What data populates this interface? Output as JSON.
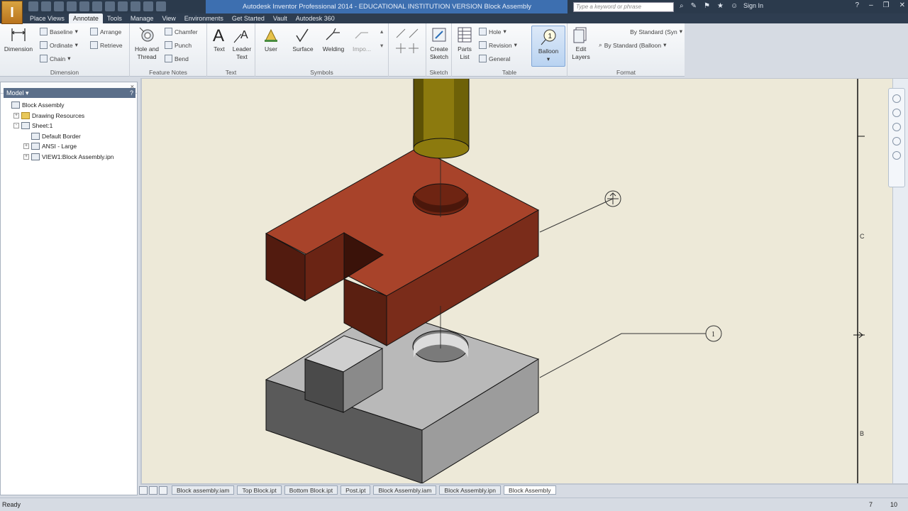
{
  "app": {
    "logo_letter": "I",
    "window_title": "Autodesk Inventor Professional 2014 - EDUCATIONAL INSTITUTION VERSION   Block Assembly",
    "search_placeholder": "Type a keyword or phrase",
    "sign_in": "Sign In"
  },
  "tabs": [
    "Place Views",
    "Annotate",
    "Tools",
    "Manage",
    "View",
    "Environments",
    "Get Started",
    "Vault",
    "Autodesk 360"
  ],
  "active_tab": "Annotate",
  "ribbon": {
    "dimension": {
      "title": "Dimension",
      "big": "Dimension",
      "small": [
        "Baseline",
        "Ordinate",
        "Chain",
        "Arrange",
        "Retrieve"
      ]
    },
    "feature_notes": {
      "title": "Feature Notes",
      "big": [
        "Hole and",
        "Thread"
      ],
      "small": [
        "Chamfer",
        "Punch",
        "Bend"
      ]
    },
    "text": {
      "title": "Text",
      "buttons": [
        {
          "label1": "Text",
          "label2": ""
        },
        {
          "label1": "Leader",
          "label2": "Text"
        }
      ]
    },
    "symbols": {
      "title": "Symbols",
      "buttons": [
        "User",
        "Surface",
        "Welding",
        "Impo..."
      ]
    },
    "sketch": {
      "title": "Sketch",
      "big": [
        "Create",
        "Sketch"
      ]
    },
    "table": {
      "title": "Table",
      "big": [
        "Parts",
        "List"
      ],
      "small": [
        "Hole",
        "Revision",
        "General"
      ],
      "balloon": "Balloon"
    },
    "format": {
      "title": "Format",
      "edit_layers": [
        "Edit",
        "Layers"
      ],
      "style1": "By Standard (Syn",
      "style2": "By Standard (Balloon"
    }
  },
  "browser": {
    "title": "Model",
    "nodes": [
      {
        "label": "Block Assembly",
        "expander": "",
        "indent": 0
      },
      {
        "label": "Drawing Resources",
        "expander": "+",
        "indent": 1
      },
      {
        "label": "Sheet:1",
        "expander": "-",
        "indent": 1
      },
      {
        "label": "Default Border",
        "expander": "",
        "indent": 2
      },
      {
        "label": "ANSI - Large",
        "expander": "+",
        "indent": 2
      },
      {
        "label": "VIEW1:Block Assembly.ipn",
        "expander": "+",
        "indent": 2
      }
    ]
  },
  "drawing": {
    "balloon_item": "1",
    "border_letters": [
      "C",
      "B"
    ],
    "colors": {
      "top_block": "#a8432a",
      "bottom_block": "#a9a9a9",
      "post": "#8c7a0e",
      "sheet": "#ede9d8"
    }
  },
  "doc_tabs": [
    "Block assembly.iam",
    "Top Block.ipt",
    "Bottom Block.ipt",
    "Post.ipt",
    "Block Assembly.iam",
    "Block Assembly.ipn",
    "Block Assembly"
  ],
  "status": {
    "text": "Ready",
    "n1": "7",
    "n2": "10"
  }
}
